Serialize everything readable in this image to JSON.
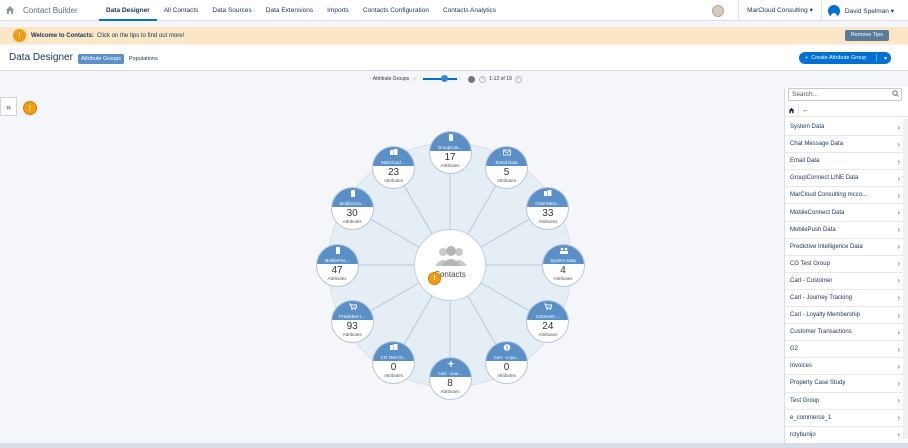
{
  "app": {
    "title": "Contact Builder"
  },
  "nav": {
    "tabs": [
      "Data Designer",
      "All Contacts",
      "Data Sources",
      "Data Extensions",
      "Imports",
      "Contacts Configuration",
      "Contacts Analytics"
    ],
    "business_unit": "MarCloud Consulting ▾",
    "user": "David Spelman ▾"
  },
  "tips": {
    "title": "Welcome to Contacts:",
    "text": "Click on the tips to find out more!",
    "remove_label": "Remove Tips"
  },
  "header": {
    "title": "Data Designer",
    "tab_active": "Attribute Groups",
    "tab_other": "Populations",
    "create_label": "Create Attribute Group"
  },
  "toolbar": {
    "label": "· Attribute Groups",
    "pagination": "1-12 of 19"
  },
  "center": {
    "label": "Contacts"
  },
  "groups": [
    {
      "name": "GroupCon...",
      "count": "17",
      "unit": "Attributes",
      "icon": "phone-icon"
    },
    {
      "name": "Email Data",
      "count": "5",
      "unit": "Attributes",
      "icon": "envelope-icon"
    },
    {
      "name": "Chat Mess...",
      "count": "33",
      "unit": "Attributes",
      "icon": "database-icon"
    },
    {
      "name": "System Data",
      "count": "4",
      "unit": "Attributes",
      "icon": "people-icon"
    },
    {
      "name": "Customer ...",
      "count": "24",
      "unit": "Attributes",
      "icon": "cart-icon"
    },
    {
      "name": "Carl - Loya...",
      "count": "0",
      "unit": "Attributes",
      "icon": "dollar-icon"
    },
    {
      "name": "Carl - Jour...",
      "count": "8",
      "unit": "Attributes",
      "icon": "plane-icon"
    },
    {
      "name": "CG Test Gr...",
      "count": "0",
      "unit": "Attributes",
      "icon": "database-icon"
    },
    {
      "name": "Predictive I...",
      "count": "93",
      "unit": "Attributes",
      "icon": "cart-icon"
    },
    {
      "name": "MobilePus...",
      "count": "47",
      "unit": "Attributes",
      "icon": "phone-icon"
    },
    {
      "name": "MobileCon...",
      "count": "30",
      "unit": "Attributes",
      "icon": "phone-icon"
    },
    {
      "name": "MarCloud ...",
      "count": "23",
      "unit": "Attributes",
      "icon": "database-icon"
    }
  ],
  "panel": {
    "search_placeholder": "Search...",
    "items": [
      "System Data",
      "Chat Message Data",
      "Email Data",
      "GroupConnect LINE Data",
      "MarCloud Consulting mcco...",
      "MobileConnect Data",
      "MobilePush Data",
      "Predictive Intelligence Data",
      "CG Test Group",
      "Carl - Customer",
      "Carl - Journey Tracking",
      "Carl - Loyalty Membership",
      "Customer Transactions",
      "G2",
      "Invoices",
      "Property Case Study",
      "Test Group",
      "e_commerce_1",
      "rctybunijo"
    ]
  },
  "colors": {
    "accent": "#0070d2",
    "node_header": "#5a8fc7",
    "tip": "#f39c12"
  }
}
